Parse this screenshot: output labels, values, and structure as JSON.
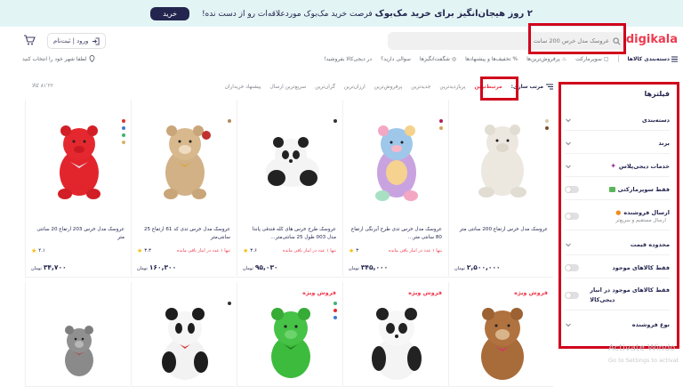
{
  "banner": {
    "text_bold": "۲ روز هیجان‌انگیز برای خرید مک‌بوک",
    "text_rest": " فرصت خرید مک‌بوک موردعلاقه‌ات رو از دست نده!",
    "button": "خرید"
  },
  "header": {
    "logo": "digikala",
    "search_placeholder": "عروسک مدل خرس 200 سانت",
    "login_label": "ورود | ثبت‌نام"
  },
  "nav": {
    "categories": "دسته‌بندی کالاها",
    "items": [
      "سوپرمارکت",
      "پرفروش‌ترین‌ها",
      "تخفیف‌ها و پیشنهادها",
      "شگفت‌انگیزها",
      "سوالی دارید؟",
      "در دیجی‌کالا بفروشید!"
    ],
    "location": "لطفا شهر خود را انتخاب کنید"
  },
  "sidebar": {
    "title": "فیلترها",
    "filters": [
      {
        "label": "دسته‌بندی",
        "kind": "chevron"
      },
      {
        "label": "برند",
        "kind": "chevron"
      },
      {
        "label": "خدمات دیجی‌پلاس",
        "kind": "chevron",
        "icon": "plus-star-icon"
      },
      {
        "label": "فقط سوپرمارکتی",
        "kind": "toggle",
        "icon": "supermarket-icon"
      },
      {
        "label": "ارسال فروشنده",
        "kind": "toggle",
        "sub": "ارسال مستقیم و سریع‌تر",
        "icon": "seller-icon"
      },
      {
        "label": "محدوده قیمت",
        "kind": "chevron"
      },
      {
        "label": "فقط کالاهای موجود",
        "kind": "toggle"
      },
      {
        "label": "فقط کالاهای موجود در انبار",
        "kind": "toggle",
        "sub": "دیجی‌کالا"
      },
      {
        "label": "نوع فروشنده",
        "kind": "chevron"
      }
    ]
  },
  "sort": {
    "label": "مرتب سازی:",
    "items": [
      "مرتبط‌ترین",
      "پربازدیدترین",
      "جدیدترین",
      "پرفروش‌ترین",
      "ارزان‌ترین",
      "گران‌ترین",
      "سریع‌ترین ارسال",
      "پیشنهاد خریداران"
    ],
    "active_index": 0,
    "count": "۸۱٬۲۲ کالا"
  },
  "products": [
    {
      "title": "عروسک مدل خرس ارتفاع 200 سانتی متر",
      "rating": "",
      "stock": "",
      "price": "۲,۵۰۰,۰۰۰",
      "toman": "تومان",
      "colors": [
        "#d9c9a8",
        "#7a4b2a"
      ],
      "toy": "white-bear",
      "special": ""
    },
    {
      "title": "عروسک مدل خرس تدی طرح آبرنگی ارتفاع 80 سانتی متر...",
      "rating": "۳",
      "stock": "تنها ۱ عدد در انبار باقی مانده",
      "price": "۳۴۵,۰۰۰",
      "toman": "تومان",
      "colors": [
        "#b0205a",
        "#d6a35a"
      ],
      "toy": "rainbow-bear",
      "special": ""
    },
    {
      "title": "عروسک طرح خرس های کله فندقی پاندا مدل 003 طول 25 سانتی‌متر...",
      "rating": "۳.۶",
      "stock": "تنها ۱ عدد در انبار باقی مانده",
      "price": "۹۵,۰۳۰",
      "toman": "تومان",
      "colors": [
        "#333333"
      ],
      "toy": "panda",
      "special": ""
    },
    {
      "title": "عروسک مدل خرس تدی کد 61 ارتفاع 25 سانتی‌متر",
      "rating": "۳.۳",
      "stock": "تنها ۱ عدد در انبار باقی مانده",
      "price": "۱۶۰,۳۰۰",
      "toman": "تومان",
      "colors": [
        "#b28b5a"
      ],
      "toy": "brown-bear",
      "special": ""
    },
    {
      "title": "عروسک مدل خرس 203 ارتفاع 20 سانتی متر",
      "rating": "۴.۱",
      "stock": "",
      "price": "۳۴,۷۰۰",
      "toman": "تومان",
      "colors": [
        "#e03030",
        "#3b7bd3",
        "#3cb371",
        "#d7b46a"
      ],
      "toy": "red-bear",
      "special": ""
    },
    {
      "title": "",
      "rating": "",
      "stock": "",
      "price": "",
      "toman": "",
      "colors": [],
      "toy": "brown-bear-2",
      "special": "فروش ویژه"
    },
    {
      "title": "",
      "rating": "",
      "stock": "",
      "price": "",
      "toman": "",
      "colors": [],
      "toy": "panda-sit",
      "special": "فروش ویژه"
    },
    {
      "title": "",
      "rating": "",
      "stock": "",
      "price": "",
      "toman": "",
      "colors": [
        "#3cb371",
        "#e03030",
        "#3b7bd3"
      ],
      "toy": "green-bear",
      "special": "فروش ویژه"
    },
    {
      "title": "",
      "rating": "",
      "stock": "",
      "price": "",
      "toman": "",
      "colors": [
        "#333333"
      ],
      "toy": "panda-two",
      "special": ""
    },
    {
      "title": "",
      "rating": "",
      "stock": "",
      "price": "",
      "toman": "",
      "colors": [],
      "toy": "grey-bear",
      "special": ""
    }
  ],
  "watermark": {
    "line1": "Activate Windo",
    "line2": "Go to Settings to activat"
  }
}
